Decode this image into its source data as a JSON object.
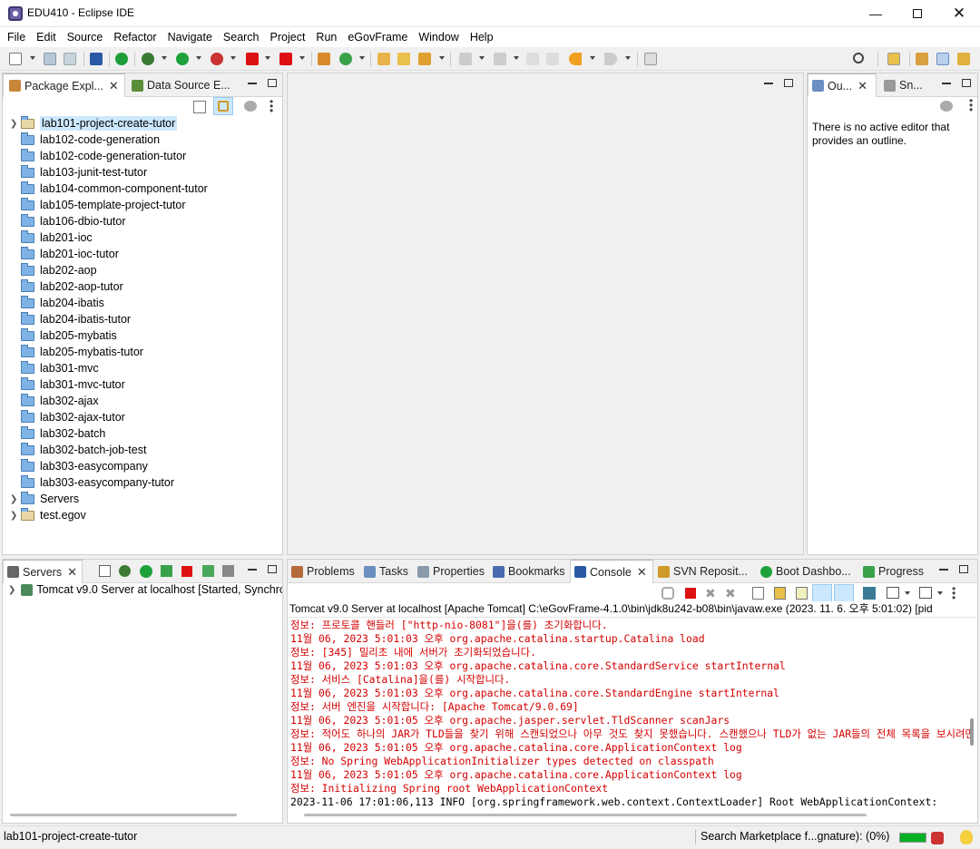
{
  "window": {
    "title": "EDU410 - Eclipse IDE"
  },
  "menu": [
    "File",
    "Edit",
    "Source",
    "Refactor",
    "Navigate",
    "Search",
    "Project",
    "Run",
    "eGovFrame",
    "Window",
    "Help"
  ],
  "left_panel": {
    "tab_package_explorer": "Package Expl...",
    "tab_data_source": "Data Source E...",
    "projects": [
      {
        "name": "lab101-project-create-tutor",
        "selected": true,
        "icon": "project-icon",
        "expandable": true
      },
      {
        "name": "lab102-code-generation",
        "icon": "folder-icon"
      },
      {
        "name": "lab102-code-generation-tutor",
        "icon": "folder-icon"
      },
      {
        "name": "lab103-junit-test-tutor",
        "icon": "folder-icon"
      },
      {
        "name": "lab104-common-component-tutor",
        "icon": "folder-icon"
      },
      {
        "name": "lab105-template-project-tutor",
        "icon": "folder-icon"
      },
      {
        "name": "lab106-dbio-tutor",
        "icon": "folder-icon"
      },
      {
        "name": "lab201-ioc",
        "icon": "folder-icon"
      },
      {
        "name": "lab201-ioc-tutor",
        "icon": "folder-icon"
      },
      {
        "name": "lab202-aop",
        "icon": "folder-icon"
      },
      {
        "name": "lab202-aop-tutor",
        "icon": "folder-icon"
      },
      {
        "name": "lab204-ibatis",
        "icon": "folder-icon"
      },
      {
        "name": "lab204-ibatis-tutor",
        "icon": "folder-icon"
      },
      {
        "name": "lab205-mybatis",
        "icon": "folder-icon"
      },
      {
        "name": "lab205-mybatis-tutor",
        "icon": "folder-icon"
      },
      {
        "name": "lab301-mvc",
        "icon": "folder-icon"
      },
      {
        "name": "lab301-mvc-tutor",
        "icon": "folder-icon"
      },
      {
        "name": "lab302-ajax",
        "icon": "folder-icon"
      },
      {
        "name": "lab302-ajax-tutor",
        "icon": "folder-icon"
      },
      {
        "name": "lab302-batch",
        "icon": "folder-icon"
      },
      {
        "name": "lab302-batch-job-test",
        "icon": "folder-icon"
      },
      {
        "name": "lab303-easycompany",
        "icon": "folder-icon"
      },
      {
        "name": "lab303-easycompany-tutor",
        "icon": "folder-icon"
      },
      {
        "name": "Servers",
        "icon": "folder-icon",
        "expandable": true
      },
      {
        "name": "test.egov",
        "icon": "project-icon",
        "expandable": true
      }
    ]
  },
  "outline": {
    "tab_outline": "Ou...",
    "tab_snippets": "Sn...",
    "message": "There is no active editor that provides an outline."
  },
  "servers": {
    "tab": "Servers",
    "entry": "Tomcat v9.0 Server at localhost  [Started, Synchro"
  },
  "bottom_tabs": {
    "problems": "Problems",
    "tasks": "Tasks",
    "properties": "Properties",
    "bookmarks": "Bookmarks",
    "console": "Console",
    "svn": "SVN Reposit...",
    "boot": "Boot Dashbo...",
    "progress": "Progress"
  },
  "console": {
    "header": "Tomcat v9.0 Server at localhost [Apache Tomcat] C:\\eGovFrame-4.1.0\\bin\\jdk8u242-b08\\bin\\javaw.exe  (2023. 11. 6. 오후 5:01:02) [pid",
    "lines": [
      {
        "text": "정보: 프로토콜 핸들러 [\"http-nio-8081\"]을(를) 초기화합니다.",
        "color": "red"
      },
      {
        "text": "11월 06, 2023 5:01:03 오후 org.apache.catalina.startup.Catalina load",
        "color": "red"
      },
      {
        "text": "정보: [345] 밀리초 내에 서버가 초기화되었습니다.",
        "color": "red"
      },
      {
        "text": "11월 06, 2023 5:01:03 오후 org.apache.catalina.core.StandardService startInternal",
        "color": "red"
      },
      {
        "text": "정보: 서비스 [Catalina]을(를) 시작합니다.",
        "color": "red"
      },
      {
        "text": "11월 06, 2023 5:01:03 오후 org.apache.catalina.core.StandardEngine startInternal",
        "color": "red"
      },
      {
        "text": "정보: 서버 엔진을 시작합니다: [Apache Tomcat/9.0.69]",
        "color": "red"
      },
      {
        "text": "11월 06, 2023 5:01:05 오후 org.apache.jasper.servlet.TldScanner scanJars",
        "color": "red"
      },
      {
        "text": "정보: 적어도 하나의 JAR가 TLD들을 찾기 위해 스캔되었으나 아무 것도 찾지 못했습니다. 스캔했으나 TLD가 없는 JAR들의 전체 목록을 보시려면,",
        "color": "red"
      },
      {
        "text": "11월 06, 2023 5:01:05 오후 org.apache.catalina.core.ApplicationContext log",
        "color": "red"
      },
      {
        "text": "정보: No Spring WebApplicationInitializer types detected on classpath",
        "color": "red"
      },
      {
        "text": "11월 06, 2023 5:01:05 오후 org.apache.catalina.core.ApplicationContext log",
        "color": "red"
      },
      {
        "text": "정보: Initializing Spring root WebApplicationContext",
        "color": "red"
      },
      {
        "text": "2023-11-06 17:01:06,113  INFO [org.springframework.web.context.ContextLoader] Root WebApplicationContext:",
        "color": "black"
      }
    ]
  },
  "status": {
    "left": "lab101-project-create-tutor",
    "right": "Search Marketplace f...gnature): (0%)",
    "help": "(?)"
  },
  "colors": {
    "accent": "#0078d7",
    "error": "#d40000",
    "progress": "#06b025",
    "selection": "#cce8ff"
  }
}
